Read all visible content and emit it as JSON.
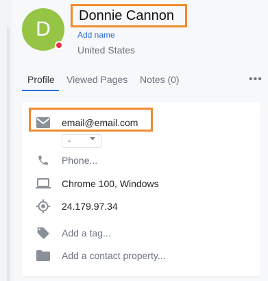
{
  "contact": {
    "initial": "D",
    "name": "Donnie Cannon",
    "add_name_link": "Add name",
    "location": "United States"
  },
  "tabs": [
    {
      "label": "Profile",
      "active": true
    },
    {
      "label": "Viewed Pages",
      "active": false
    },
    {
      "label": "Notes (0)",
      "active": false
    }
  ],
  "details": {
    "email": "email@email.com",
    "email_type": "-",
    "phone_placeholder": "Phone...",
    "browser": "Chrome 100, Windows",
    "ip": "24.179.97.34",
    "tag_placeholder": "Add a tag...",
    "property_placeholder": "Add a contact property..."
  },
  "colors": {
    "accent": "#2a6fdb",
    "highlight": "#f28a2b",
    "avatar_bg": "#96c444",
    "status_offline": "#e2334a"
  },
  "icons": [
    "email-icon",
    "phone-icon",
    "laptop-icon",
    "location-target-icon",
    "tag-icon",
    "folder-icon",
    "more-icon"
  ]
}
